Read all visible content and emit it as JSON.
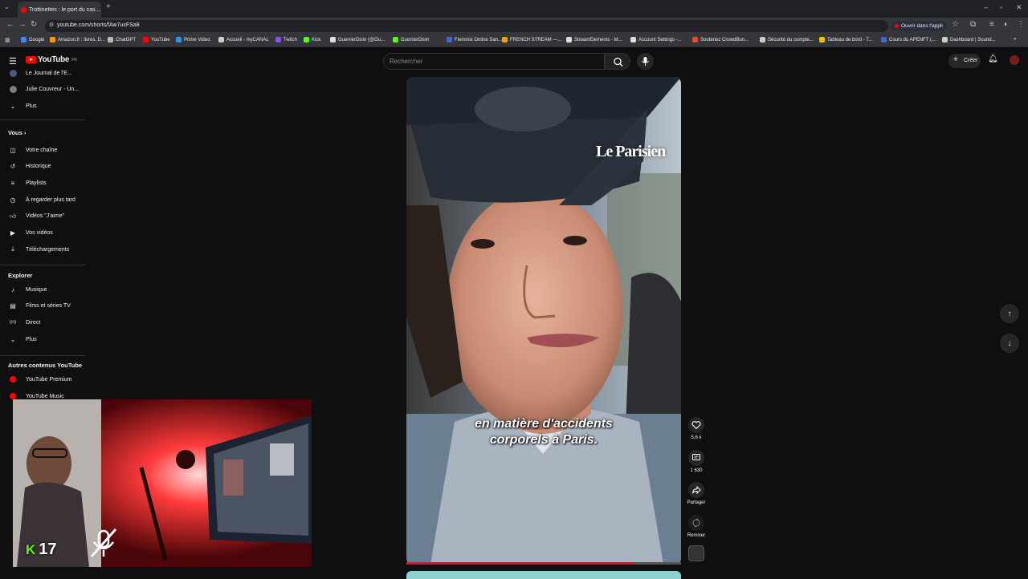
{
  "browser": {
    "tab_title": "Trottinettes : le port du cas…",
    "url": "youtube.com/shorts/fAw7uxFSa8",
    "open_in_app": "Ouvrir dans l'appli",
    "bookmarks": [
      {
        "label": "Google",
        "color": "#4285f4"
      },
      {
        "label": "Amazon.fr : livres, D...",
        "color": "#ff9900"
      },
      {
        "label": "ChatGPT",
        "color": "#bbbbbb"
      },
      {
        "label": "YouTube",
        "color": "#ff0000"
      },
      {
        "label": "Prime Video",
        "color": "#1a98ff"
      },
      {
        "label": "Accueil - myCANAL",
        "color": "#cccccc"
      },
      {
        "label": "Twitch",
        "color": "#9146ff"
      },
      {
        "label": "Kick",
        "color": "#53fc18"
      },
      {
        "label": "GuerrierDivin (@Gu...",
        "color": "#dddddd"
      },
      {
        "label": "GuerrierDivin",
        "color": "#53fc18"
      },
      {
        "label": "Flemmix Online San...",
        "color": "#3a6ad6"
      },
      {
        "label": "FRENCH STREAM —...",
        "color": "#f2a20c"
      },
      {
        "label": "StreamElements - M...",
        "color": "#dddddd"
      },
      {
        "label": "Account Settings -...",
        "color": "#dddddd"
      },
      {
        "label": "Soutenez CrowdBun...",
        "color": "#e44b2f"
      },
      {
        "label": "Sécurité du compte...",
        "color": "#cccccc"
      },
      {
        "label": "Tableau de bord - T...",
        "color": "#f2c200"
      },
      {
        "label": "Cours du APENFT (...",
        "color": "#3a6ad6"
      },
      {
        "label": "Dashboard | Sound...",
        "color": "#cccccc"
      }
    ]
  },
  "header": {
    "logo_text": "YouTube",
    "logo_country": "FR",
    "search_placeholder": "Rechercher",
    "create_label": "Créer"
  },
  "sidebar": {
    "top_items": [
      {
        "label": "Le Journal de l'E..."
      },
      {
        "label": "Julie Couvreur - Un..."
      },
      {
        "label": "Plus"
      }
    ],
    "you_heading": "Vous",
    "you_items": [
      {
        "label": "Votre chaîne",
        "icon": "channel-icon"
      },
      {
        "label": "Historique",
        "icon": "history-icon"
      },
      {
        "label": "Playlists",
        "icon": "playlists-icon"
      },
      {
        "label": "À regarder plus tard",
        "icon": "watch-later-icon"
      },
      {
        "label": "Vidéos \"J'aime\"",
        "icon": "liked-icon"
      },
      {
        "label": "Vos vidéos",
        "icon": "your-videos-icon"
      },
      {
        "label": "Téléchargements",
        "icon": "downloads-icon"
      }
    ],
    "explore_heading": "Explorer",
    "explore_items": [
      {
        "label": "Musique",
        "icon": "music-icon"
      },
      {
        "label": "Films et séries TV",
        "icon": "films-icon"
      },
      {
        "label": "Direct",
        "icon": "live-icon"
      },
      {
        "label": "Plus",
        "icon": "chevron-down-icon"
      }
    ],
    "other_heading": "Autres contenus YouTube",
    "other_items": [
      {
        "label": "YouTube Premium"
      },
      {
        "label": "YouTube Music"
      }
    ]
  },
  "short": {
    "subtitle_line1": "en matière d'accidents",
    "subtitle_line2": "corporels à Paris.",
    "watermark": "Le Parisien",
    "progress_percent": 83,
    "likes": "5,6 k",
    "comments": "1 630",
    "share_label": "Partager",
    "remix_label": "Remixer"
  },
  "webcam": {
    "platform_letter": "K",
    "viewer_count": "17"
  },
  "colors": {
    "background": "#0f0f0f",
    "brand_red": "#ff0000",
    "kick_green": "#53fc18"
  }
}
